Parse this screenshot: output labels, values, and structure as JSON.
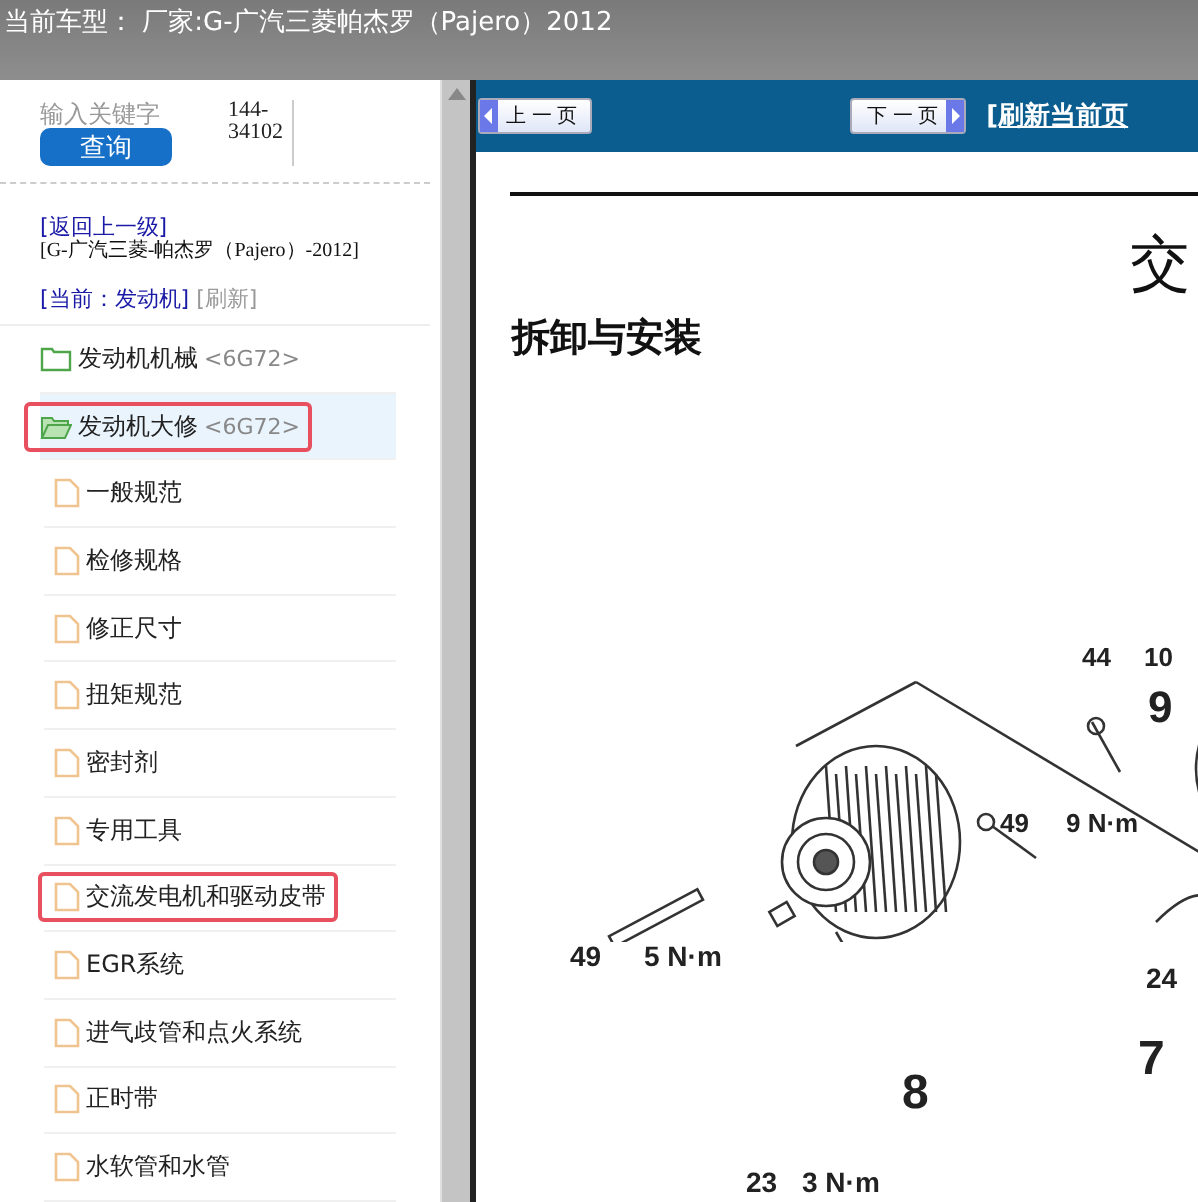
{
  "header": {
    "label": "当前车型：",
    "value": "厂家:G-广汽三菱帕杰罗（Pajero）2012"
  },
  "search": {
    "placeholder": "输入关键字",
    "code": "144-34102",
    "button": "查询"
  },
  "breadcrumb": {
    "back": "[返回上一级]",
    "model": "[G-广汽三菱-帕杰罗（Pajero）-2012]",
    "current": "[当前：发动机]",
    "refresh": "[刷新]"
  },
  "tree": [
    {
      "label": "发动机机械",
      "tag": "<6G72>",
      "expanded": false,
      "selected": false,
      "highlighted": false
    },
    {
      "label": "发动机大修",
      "tag": "<6G72>",
      "expanded": true,
      "selected": true,
      "highlighted": true,
      "children": [
        {
          "label": "一般规范",
          "selected": false,
          "highlighted": false
        },
        {
          "label": "检修规格",
          "selected": false,
          "highlighted": false
        },
        {
          "label": "修正尺寸",
          "selected": false,
          "highlighted": false
        },
        {
          "label": "扭矩规范",
          "selected": false,
          "highlighted": false
        },
        {
          "label": "密封剂",
          "selected": false,
          "highlighted": false
        },
        {
          "label": "专用工具",
          "selected": false,
          "highlighted": false
        },
        {
          "label": "交流发电机和驱动皮带",
          "selected": false,
          "highlighted": true
        },
        {
          "label": "EGR系统",
          "selected": false,
          "highlighted": false
        },
        {
          "label": "进气歧管和点火系统",
          "selected": false,
          "highlighted": false
        },
        {
          "label": "正时带",
          "selected": false,
          "highlighted": false
        },
        {
          "label": "水软管和水管",
          "selected": false,
          "highlighted": false
        }
      ]
    }
  ],
  "toolbar": {
    "prev": "上 一 页",
    "next": "下 一 页",
    "refresh": "[刷新当前页"
  },
  "document": {
    "title": "交",
    "section": "拆卸与安装",
    "callouts": [
      "44",
      "10",
      "9",
      "49",
      "9 N·m",
      "24",
      "49",
      "5 N·m",
      "8",
      "7",
      "23",
      "3 N·m"
    ]
  }
}
